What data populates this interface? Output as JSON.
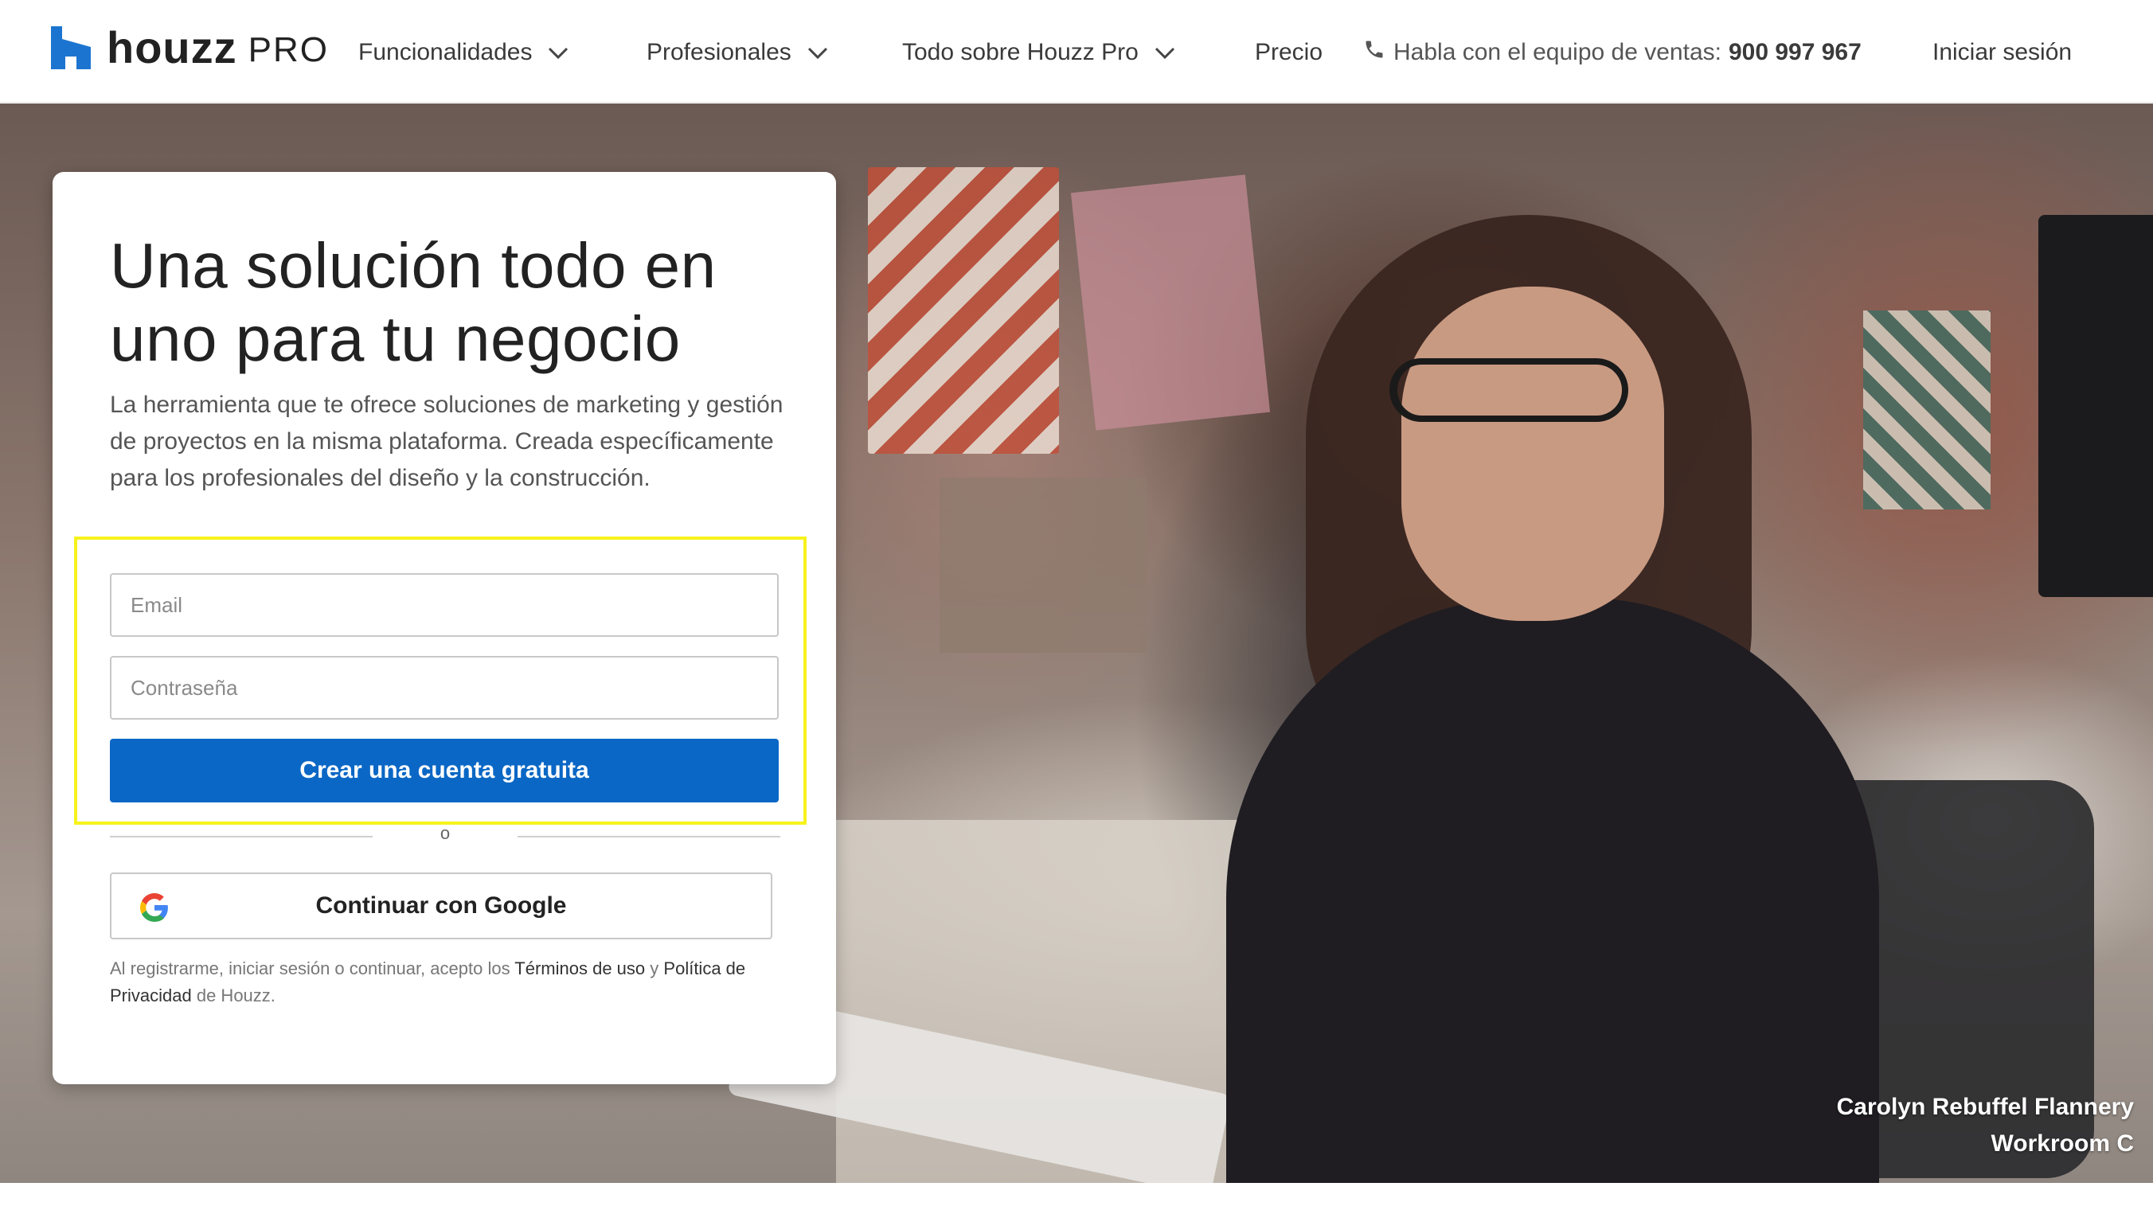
{
  "header": {
    "logo_text": "houzz",
    "logo_suffix": "PRO",
    "nav": [
      {
        "label": "Funcionalidades",
        "icon": "chevron-down-icon"
      },
      {
        "label": "Profesionales",
        "icon": "chevron-down-icon"
      },
      {
        "label": "Todo sobre Houzz Pro",
        "icon": "chevron-down-icon"
      },
      {
        "label": "Precio"
      }
    ],
    "phone": {
      "icon": "phone-icon",
      "text": "Habla con el equipo de ventas:",
      "number": "900 997 967"
    },
    "login_label": "Iniciar sesión"
  },
  "card": {
    "title": "Una solución todo en uno para tu negocio",
    "description": "La herramienta que te ofrece soluciones de marketing y gestión de proyectos en la misma plataforma. Creada específicamente para los profesionales del diseño y la construcción.",
    "email_placeholder": "Email",
    "email_value": "",
    "password_placeholder": "Contraseña",
    "password_value": "",
    "submit_label": "Crear una cuenta gratuita",
    "divider_text": "o",
    "google_label": "Continuar con Google",
    "legal": {
      "prefix": "Al registrarme, iniciar sesión o continuar, acepto los",
      "terms": "Términos de uso",
      "and": "y",
      "privacy": "Política de Privacidad",
      "suffix": "de Houzz."
    }
  },
  "hero": {
    "credit_name": "Carolyn Rebuffel Flannery",
    "credit_company": "Workroom C"
  },
  "colors": {
    "brand_blue": "#0a67c5",
    "logo_blue": "#1b75d0",
    "highlight_yellow": "#f7f21c"
  }
}
